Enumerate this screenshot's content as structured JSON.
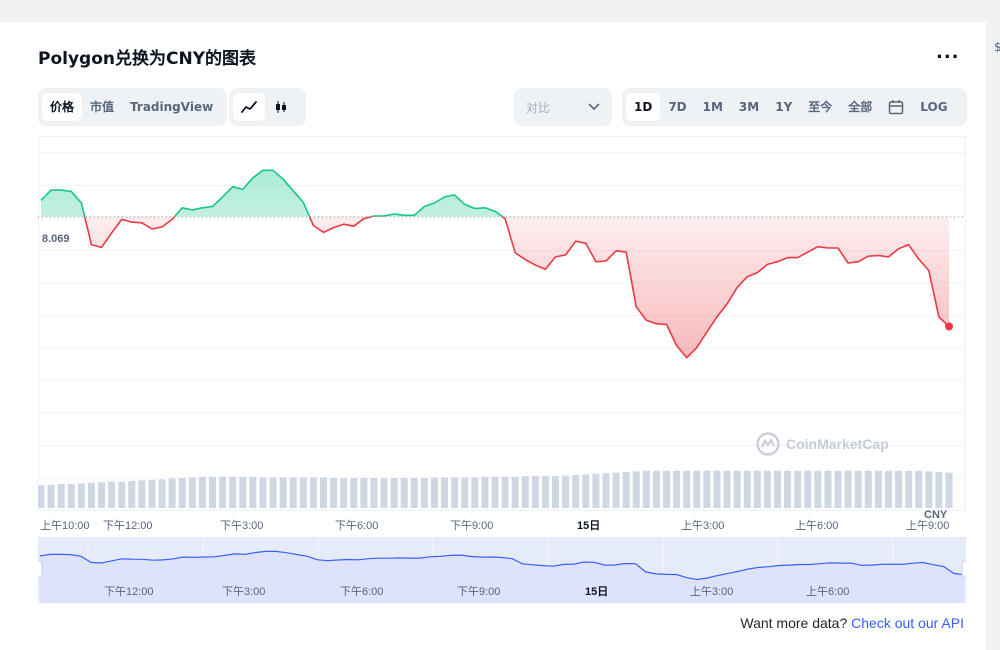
{
  "title": "Polygon兑换为CNY的图表",
  "more_label": "...",
  "edge_mark": "$",
  "view_tabs": [
    "价格",
    "市值",
    "TradingView"
  ],
  "compare": {
    "label": "对比"
  },
  "ranges": [
    "1D",
    "7D",
    "1M",
    "3M",
    "1Y",
    "至今",
    "全部"
  ],
  "log_label": "LOG",
  "watermark": "CoinMarketCap",
  "currency_label": "CNY",
  "api": {
    "text": "Want more data?",
    "link": "Check out our API"
  },
  "colors": {
    "up": "#16c784",
    "down": "#ea3943",
    "accent": "#3861fb"
  },
  "chart_data": {
    "type": "line",
    "reference_price": "8.069",
    "reference_value": 8.069,
    "ylim": [
      7.74,
      8.18
    ],
    "x_ticks": [
      "上午10:00",
      "下午12:00",
      "下午3:00",
      "下午6:00",
      "下午9:00",
      "15日",
      "上午3:00",
      "上午6:00",
      "上午9:00"
    ],
    "navigator_ticks": [
      "下午12:00",
      "下午3:00",
      "下午6:00",
      "下午9:00",
      "15日",
      "上午3:00",
      "上午6:00"
    ],
    "series": [
      {
        "values": [
          8.093,
          8.108,
          8.108,
          8.106,
          8.089,
          8.028,
          8.024,
          8.045,
          8.065,
          8.061,
          8.06,
          8.051,
          8.054,
          8.065,
          8.082,
          8.079,
          8.082,
          8.084,
          8.098,
          8.113,
          8.109,
          8.126,
          8.137,
          8.137,
          8.124,
          8.107,
          8.09,
          8.056,
          8.046,
          8.053,
          8.058,
          8.055,
          8.066,
          8.07,
          8.07,
          8.073,
          8.071,
          8.071,
          8.084,
          8.089,
          8.098,
          8.101,
          8.087,
          8.081,
          8.082,
          8.077,
          8.066,
          8.016,
          8.006,
          7.998,
          7.992,
          8.01,
          8.013,
          8.033,
          8.03,
          8.003,
          8.004,
          8.019,
          8.017,
          7.937,
          7.917,
          7.912,
          7.911,
          7.88,
          7.862,
          7.877,
          7.9,
          7.922,
          7.941,
          7.965,
          7.981,
          7.987,
          7.999,
          8.003,
          8.009,
          8.009,
          8.017,
          8.025,
          8.023,
          8.023,
          8.001,
          8.003,
          8.011,
          8.012,
          8.01,
          8.022,
          8.028,
          8.007,
          7.99,
          7.922,
          7.908
        ],
        "volume": [
          0.38,
          0.39,
          0.4,
          0.4,
          0.41,
          0.42,
          0.43,
          0.44,
          0.44,
          0.45,
          0.46,
          0.47,
          0.48,
          0.49,
          0.5,
          0.51,
          0.52,
          0.52,
          0.52,
          0.52,
          0.52,
          0.52,
          0.51,
          0.51,
          0.51,
          0.51,
          0.51,
          0.51,
          0.51,
          0.5,
          0.5,
          0.5,
          0.5,
          0.5,
          0.5,
          0.5,
          0.5,
          0.5,
          0.5,
          0.51,
          0.51,
          0.51,
          0.51,
          0.51,
          0.52,
          0.52,
          0.52,
          0.52,
          0.53,
          0.53,
          0.53,
          0.53,
          0.54,
          0.55,
          0.56,
          0.57,
          0.58,
          0.59,
          0.6,
          0.61,
          0.62,
          0.62,
          0.62,
          0.62,
          0.62,
          0.62,
          0.62,
          0.62,
          0.62,
          0.62,
          0.62,
          0.62,
          0.62,
          0.62,
          0.62,
          0.62,
          0.62,
          0.62,
          0.62,
          0.62,
          0.62,
          0.62,
          0.62,
          0.62,
          0.62,
          0.62,
          0.62,
          0.62,
          0.61,
          0.6,
          0.59
        ]
      }
    ]
  }
}
